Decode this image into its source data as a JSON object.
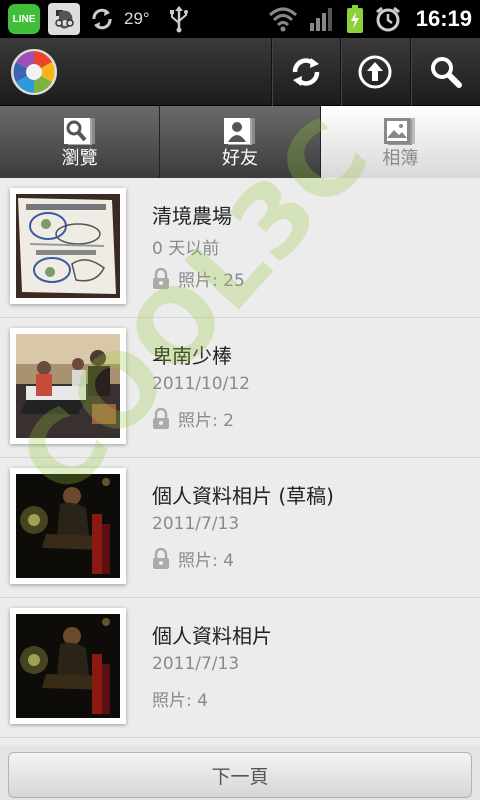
{
  "status_bar": {
    "line_label": "LINE",
    "temperature": "29°",
    "time": "16:19",
    "icons": [
      "line-icon",
      "evernote-icon",
      "sync-icon",
      "usb-icon",
      "wifi-icon",
      "signal-icon",
      "battery-charging-icon",
      "alarm-icon"
    ]
  },
  "action_bar": {
    "logo": "picasa-logo",
    "buttons": [
      "refresh-icon",
      "upload-icon",
      "search-icon"
    ]
  },
  "tabs": [
    {
      "label": "瀏覽",
      "icon": "browse-icon",
      "active": false
    },
    {
      "label": "好友",
      "icon": "friends-icon",
      "active": false
    },
    {
      "label": "相簿",
      "icon": "albums-icon",
      "active": true
    }
  ],
  "albums": [
    {
      "title": "清境農場",
      "date": "0 天以前",
      "count": "照片: 25",
      "locked": true
    },
    {
      "title": "卑南少棒",
      "date": "2011/10/12",
      "count": "照片: 2",
      "locked": true
    },
    {
      "title": "個人資料相片 (草稿)",
      "date": "2011/7/13",
      "count": "照片: 4",
      "locked": true
    },
    {
      "title": "個人資料相片",
      "date": "2011/7/13",
      "count": "照片: 4",
      "locked": false
    }
  ],
  "watermark": "COOL3C",
  "next_page_label": "下一頁",
  "colors": {
    "status_bar": "#000000",
    "action_bar": "#2a2a2a",
    "list_bg": "#ececec",
    "line_green": "#3fbf3a",
    "battery_green": "#8bd23a"
  }
}
